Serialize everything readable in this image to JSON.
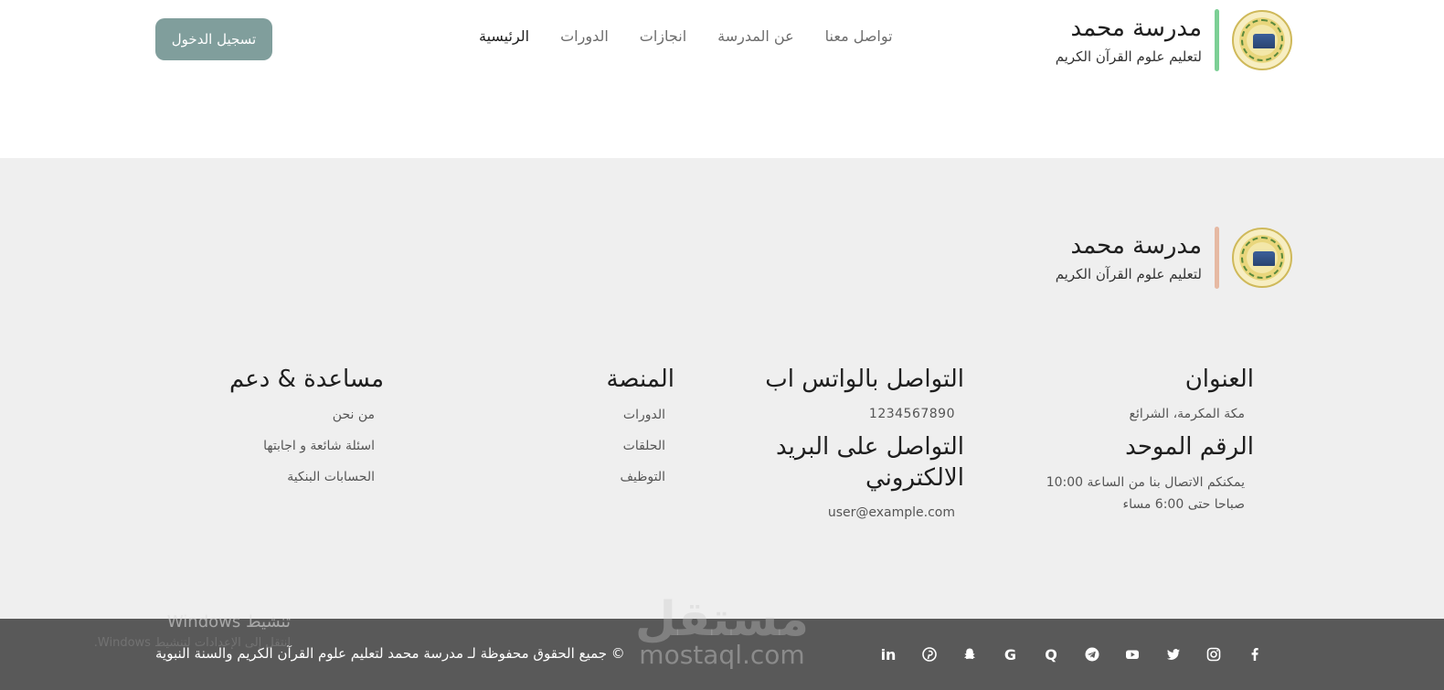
{
  "header": {
    "brand": {
      "name": "مدرسة محمد",
      "tagline": "لتعليم علوم القرآن الكريم"
    },
    "nav": [
      {
        "label": "الرئيسية",
        "active": true
      },
      {
        "label": "الدورات",
        "active": false
      },
      {
        "label": "انجازات",
        "active": false
      },
      {
        "label": "عن المدرسة",
        "active": false
      },
      {
        "label": "تواصل معنا",
        "active": false
      }
    ],
    "login_label": "تسجيل الدخول"
  },
  "footer": {
    "brand": {
      "name": "مدرسة محمد",
      "tagline": "لتعليم علوم القرآن الكريم"
    },
    "address": {
      "title": "العنوان",
      "value": "مكة المكرمة، الشرائع",
      "unified_title": "الرقم الموحد",
      "unified_value": "يمكنكم الاتصال بنا من الساعة 10:00 صباحا حتى 6:00 مساء"
    },
    "contact": {
      "whatsapp_title": "التواصل بالواتس اب",
      "whatsapp_value": "1234567890",
      "email_title": "التواصل على البريد الالكتروني",
      "email_value": "user@example.com"
    },
    "platform": {
      "title": "المنصة",
      "links": [
        "الدورات",
        "الحلقات",
        "التوظيف"
      ]
    },
    "help": {
      "title": "مساعدة & دعم",
      "links": [
        "من نحن",
        "اسئلة شائعة و اجابتها",
        "الحسابات البنكية"
      ]
    }
  },
  "bottom_bar": {
    "copyright": "© جميع الحقوق محفوظة لـ مدرسة محمد لتعليم علوم القرآن الكريم والسنة النبوية",
    "social_icons": [
      "linkedin-icon",
      "pinterest-icon",
      "snapchat-icon",
      "google-icon",
      "quora-icon",
      "telegram-icon",
      "youtube-icon",
      "twitter-icon",
      "instagram-icon",
      "facebook-icon"
    ],
    "social_glyphs": {
      "linkedin": "in",
      "google": "G",
      "quora": "Q"
    }
  },
  "overlays": {
    "watermark_arabic": "مستقل",
    "watermark_latin": "mostaql.com",
    "activation_title": "تنشيط Windows",
    "activation_sub": "انتقل إلى الإعدادات لتنشيط Windows."
  },
  "colors": {
    "login_button": "#809e9c",
    "header_accent": "#7ccf95",
    "footer_accent": "#e6b9a3",
    "footer_bg": "#efefef",
    "bottom_bar_bg": "#595959"
  }
}
